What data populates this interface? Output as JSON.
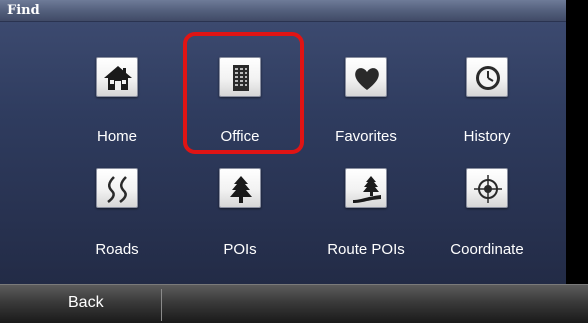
{
  "title": "Find",
  "tiles": [
    {
      "label": "Home",
      "icon": "home-icon"
    },
    {
      "label": "Office",
      "icon": "office-building-icon"
    },
    {
      "label": "Favorites",
      "icon": "heart-icon"
    },
    {
      "label": "History",
      "icon": "clock-icon"
    },
    {
      "label": "Roads",
      "icon": "road-icon"
    },
    {
      "label": "POIs",
      "icon": "tree-icon"
    },
    {
      "label": "Route POIs",
      "icon": "route-tree-icon"
    },
    {
      "label": "Coordinate",
      "icon": "crosshair-icon"
    }
  ],
  "bottom_bar": {
    "back_label": "Back"
  },
  "colors": {
    "highlight": "#e01414",
    "background": "#2f3c5f"
  }
}
